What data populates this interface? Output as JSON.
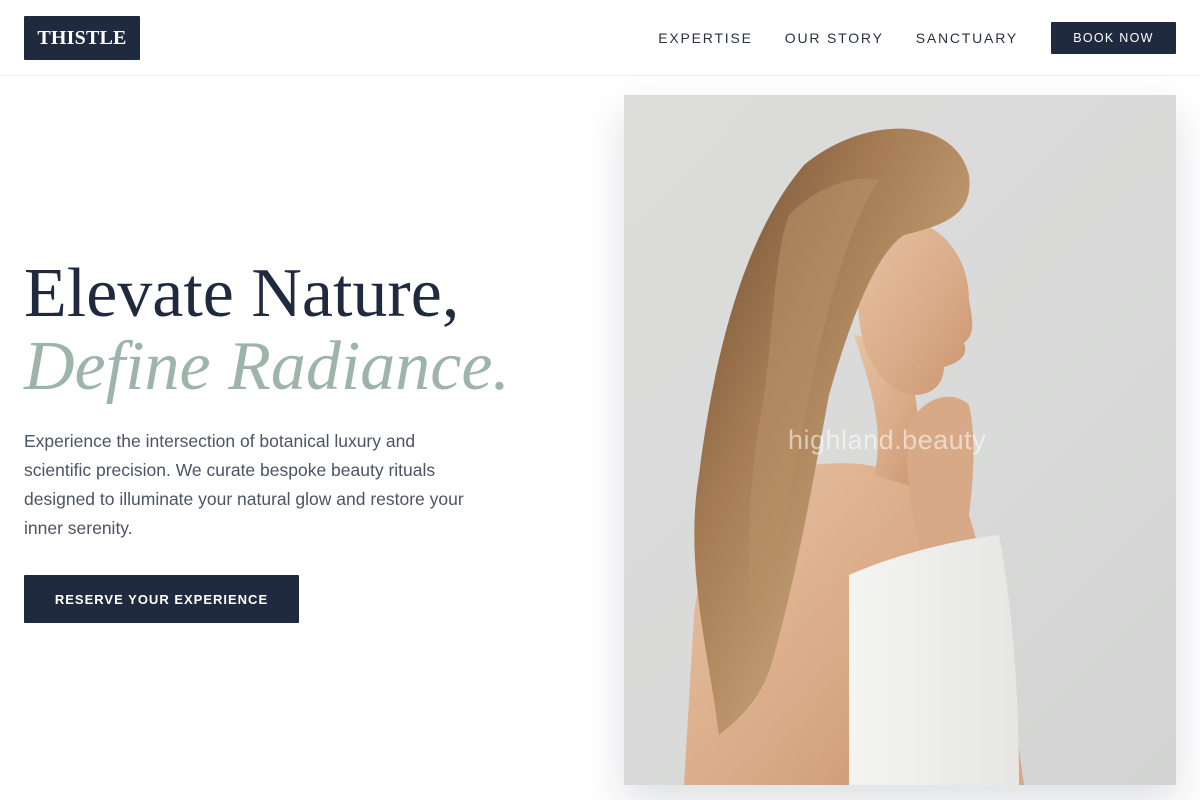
{
  "brand": {
    "logo_text": "THISTLE"
  },
  "nav": {
    "links": [
      {
        "label": "EXPERTISE"
      },
      {
        "label": "OUR STORY"
      },
      {
        "label": "SANCTUARY"
      }
    ],
    "book_label": "BOOK NOW"
  },
  "hero": {
    "headline_line1": "Elevate Nature,",
    "headline_line2": "Define Radiance.",
    "intro": "Experience the intersection of botanical luxury and scientific precision. We curate bespoke beauty rituals designed to illuminate your natural glow and restore your inner serenity.",
    "cta_label": "RESERVE YOUR EXPERIENCE",
    "image_watermark": "highland.beauty"
  },
  "colors": {
    "navy": "#1f2a3f",
    "sage": "#9db4aa",
    "body_text": "#4a5465"
  }
}
